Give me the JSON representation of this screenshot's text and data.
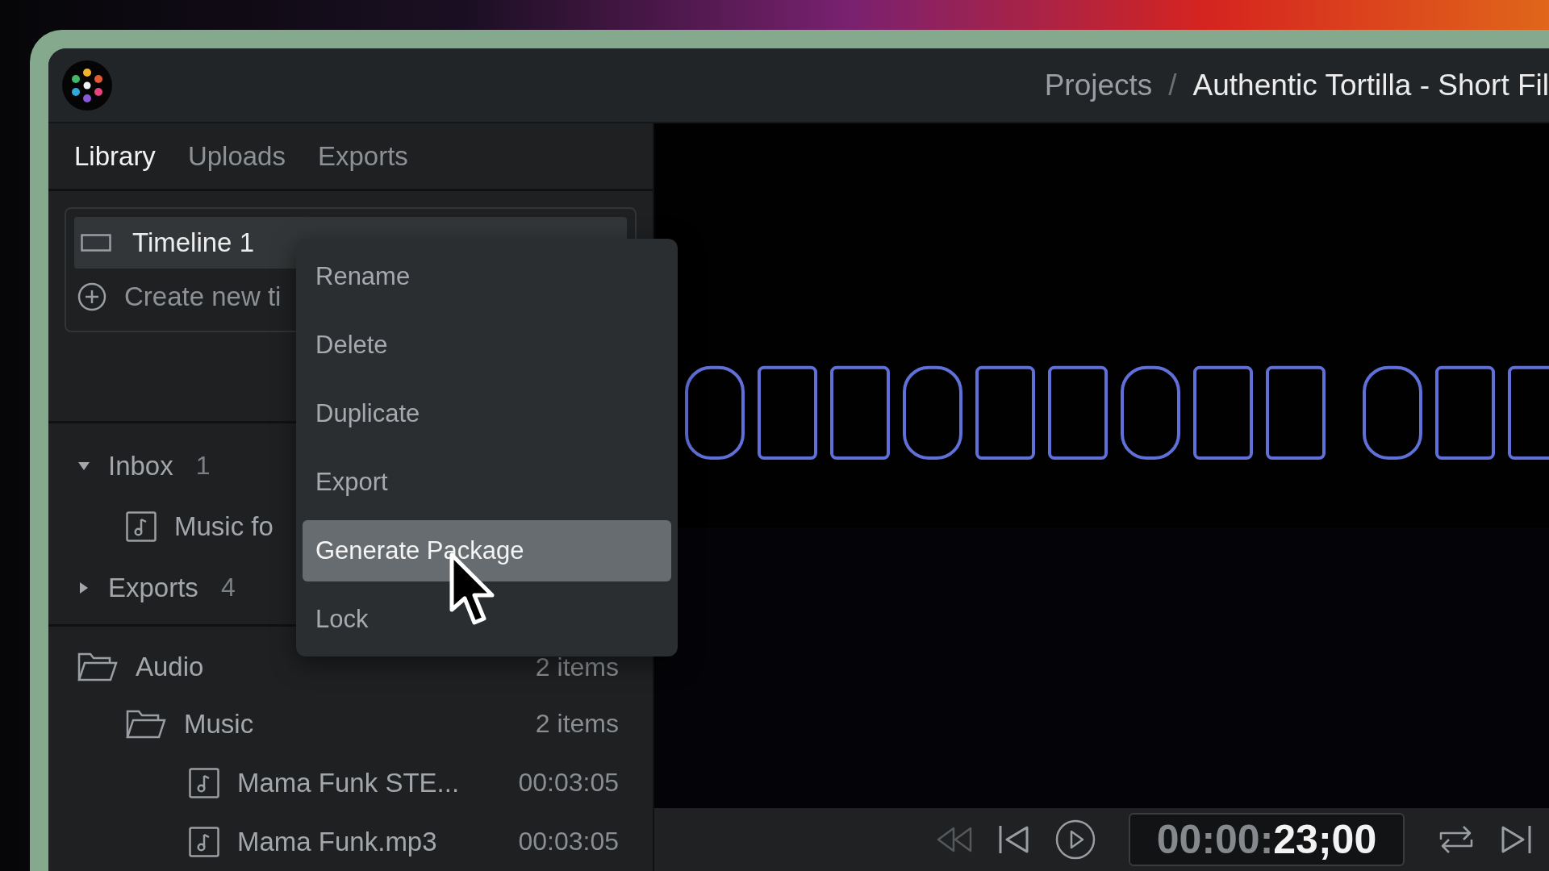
{
  "header": {
    "breadcrumb": [
      {
        "label": "Projects",
        "current": false
      },
      {
        "label": "Authentic Tortilla - Short Fil",
        "current": true
      }
    ],
    "separator": "/"
  },
  "tabs": [
    {
      "label": "Library",
      "selected": true
    },
    {
      "label": "Uploads",
      "selected": false
    },
    {
      "label": "Exports",
      "selected": false
    }
  ],
  "timelines": {
    "items": [
      {
        "label": "Timeline 1",
        "selected": true
      }
    ],
    "create": "Create new ti"
  },
  "inbox": [
    {
      "label": "Inbox",
      "count": "1",
      "expanded": true,
      "children": [
        {
          "label": "Music fo"
        }
      ]
    },
    {
      "label": "Exports",
      "count": "4",
      "expanded": false
    }
  ],
  "library": [
    {
      "kind": "folder",
      "name": "Audio",
      "meta": "2 items",
      "children": [
        {
          "kind": "folder",
          "name": "Music",
          "meta": "2 items",
          "children": [
            {
              "kind": "file",
              "name": "Mama Funk STE...",
              "meta": "00:03:05"
            },
            {
              "kind": "file",
              "name": "Mama Funk.mp3",
              "meta": "00:03:05"
            }
          ]
        }
      ]
    }
  ],
  "context_menu": [
    {
      "label": "Rename",
      "selected": false
    },
    {
      "label": "Delete",
      "selected": false
    },
    {
      "label": "Duplicate",
      "selected": false
    },
    {
      "label": "Export",
      "selected": false
    },
    {
      "label": "Generate Package",
      "selected": true
    },
    {
      "label": "Lock",
      "selected": false
    }
  ],
  "player": {
    "timecode": "00:00:**23;00**"
  }
}
